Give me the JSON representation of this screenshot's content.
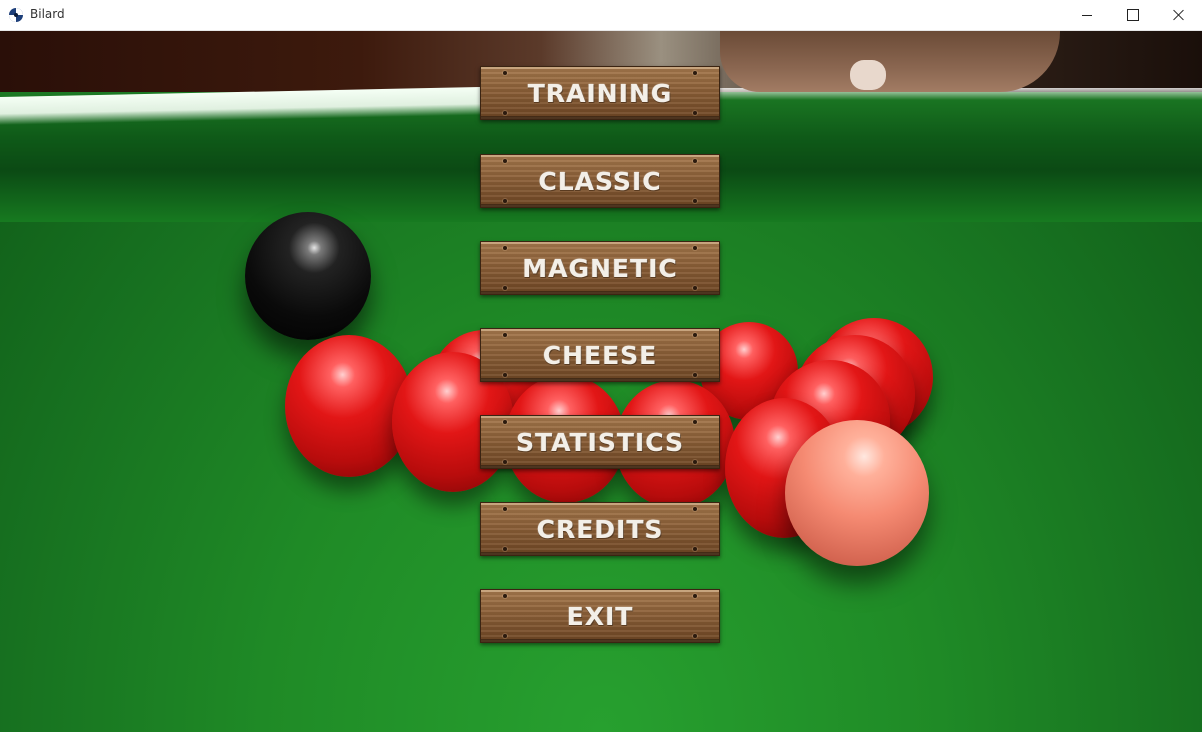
{
  "window": {
    "title": "Bilard",
    "controls": {
      "minimize_icon": "minimize-icon",
      "maximize_icon": "maximize-icon",
      "close_icon": "close-icon"
    }
  },
  "menu": {
    "buttons": [
      {
        "label": "TRAINING"
      },
      {
        "label": "CLASSIC"
      },
      {
        "label": "MAGNETIC"
      },
      {
        "label": "CHEESE"
      },
      {
        "label": "STATISTICS"
      },
      {
        "label": "CREDITS"
      },
      {
        "label": "EXIT"
      }
    ]
  },
  "colors": {
    "felt": "#1f8a26",
    "wood": "#8c6038",
    "label_text": "#f3efe8",
    "red_ball": "#e21616",
    "pink_ball": "#f58a72",
    "black_ball": "#0a0a0a"
  }
}
